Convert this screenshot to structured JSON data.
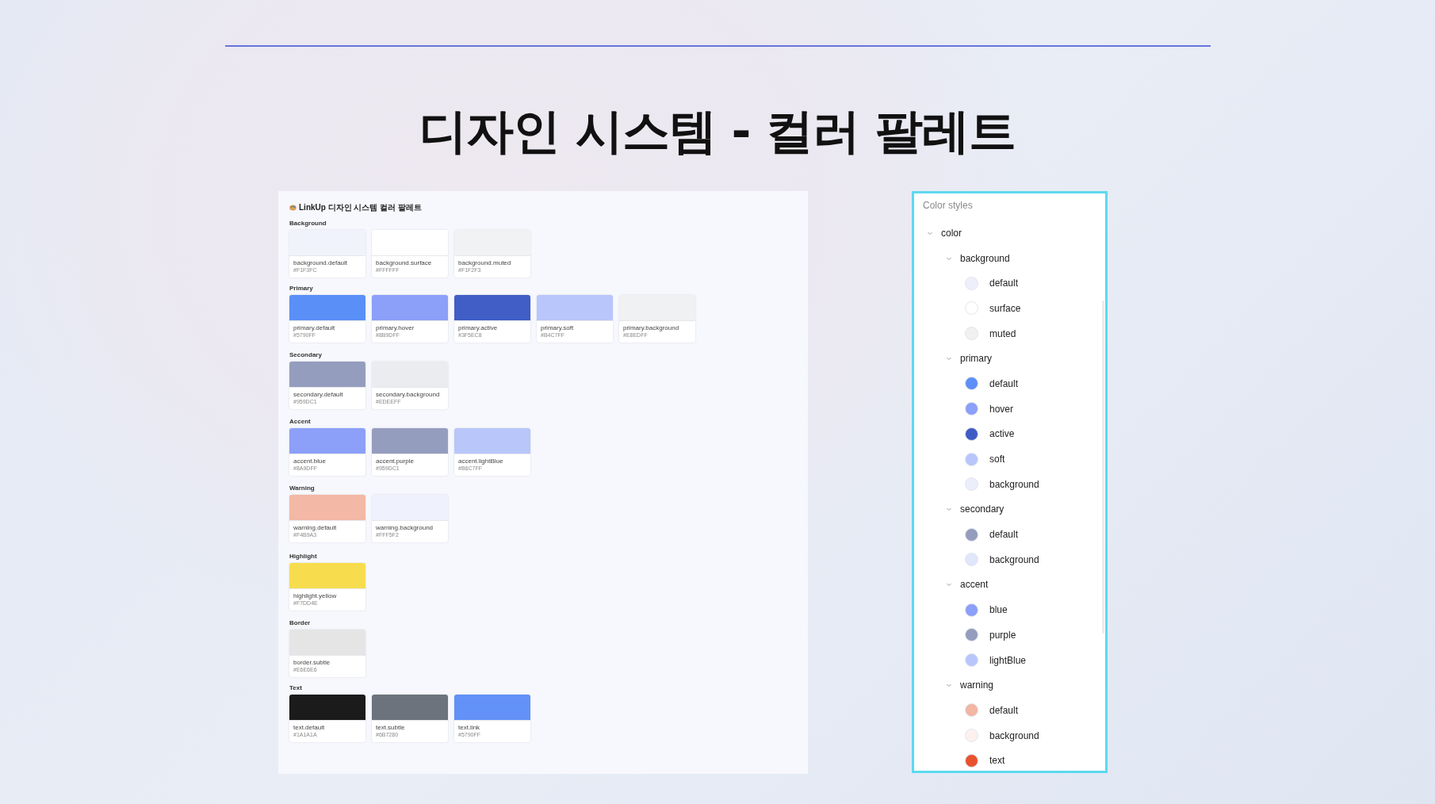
{
  "title": "디자인 시스템 - 컬러 팔레트",
  "palette": {
    "title": "LinkUp 디자인 시스템 컬러 팔레트",
    "sections": [
      {
        "heading": "Background",
        "swatches": [
          {
            "name": "background.default",
            "hex": "#F1F3FC",
            "color": "#f1f3fc"
          },
          {
            "name": "background.surface",
            "hex": "#FFFFFF",
            "color": "#ffffff"
          },
          {
            "name": "background.muted",
            "hex": "#F1F2F3",
            "color": "#f1f2f3"
          }
        ]
      },
      {
        "heading": "Primary",
        "swatches": [
          {
            "name": "primary.default",
            "hex": "#5790FF",
            "color": "#5b8ff8"
          },
          {
            "name": "primary.hover",
            "hex": "#8B9DFF",
            "color": "#8c9ff9"
          },
          {
            "name": "primary.active",
            "hex": "#3F5EC8",
            "color": "#405ec5"
          },
          {
            "name": "primary.soft",
            "hex": "#B4C7FF",
            "color": "#b8c6fb"
          },
          {
            "name": "primary.background",
            "hex": "#E8EDFF",
            "color": "#f0f1f3"
          }
        ]
      },
      {
        "heading": "Secondary",
        "swatches": [
          {
            "name": "secondary.default",
            "hex": "#959DC1",
            "color": "#959dbf"
          },
          {
            "name": "secondary.background",
            "hex": "#EDEEFF",
            "color": "#ebecef"
          }
        ]
      },
      {
        "heading": "Accent",
        "swatches": [
          {
            "name": "accent.blue",
            "hex": "#8A9DFF",
            "color": "#8c9ff9"
          },
          {
            "name": "accent.purple",
            "hex": "#959DC1",
            "color": "#959dbf"
          },
          {
            "name": "accent.lightBlue",
            "hex": "#B6C7FF",
            "color": "#b9c6fa"
          }
        ]
      },
      {
        "heading": "Warning",
        "swatches": [
          {
            "name": "warning.default",
            "hex": "#F4B9A3",
            "color": "#f3b8a6"
          },
          {
            "name": "warning.background",
            "hex": "#FFF5F2",
            "color": "#eff1fc"
          }
        ]
      },
      {
        "heading": "Highlight",
        "swatches": [
          {
            "name": "highlight.yellow",
            "hex": "#F7DD4E",
            "color": "#f7dd4e"
          }
        ]
      },
      {
        "heading": "Border",
        "swatches": [
          {
            "name": "border.subtle",
            "hex": "#E6E6E6",
            "color": "#e5e5e5"
          }
        ]
      },
      {
        "heading": "Text",
        "swatches": [
          {
            "name": "text.default",
            "hex": "#1A1A1A",
            "color": "#1b1b1b"
          },
          {
            "name": "text.subtle",
            "hex": "#6B7280",
            "color": "#6c737c"
          },
          {
            "name": "text.link",
            "hex": "#5790FF",
            "color": "#6291f7"
          }
        ]
      }
    ]
  },
  "color_styles": {
    "header": "Color styles",
    "tree": [
      {
        "label": "color",
        "expanded": true,
        "children": [
          {
            "label": "background",
            "expanded": true,
            "children": [
              {
                "label": "default",
                "color": "#edf0fa"
              },
              {
                "label": "surface",
                "color": "#ffffff"
              },
              {
                "label": "muted",
                "color": "#f1f1f1"
              }
            ]
          },
          {
            "label": "primary",
            "expanded": true,
            "children": [
              {
                "label": "default",
                "color": "#5e8ff8"
              },
              {
                "label": "hover",
                "color": "#8c9ff9"
              },
              {
                "label": "active",
                "color": "#3e5cc4"
              },
              {
                "label": "soft",
                "color": "#b8c6fb"
              },
              {
                "label": "background",
                "color": "#ebeefb"
              }
            ]
          },
          {
            "label": "secondary",
            "expanded": true,
            "children": [
              {
                "label": "default",
                "color": "#959dbf"
              },
              {
                "label": "background",
                "color": "#e0e7fb"
              }
            ]
          },
          {
            "label": "accent",
            "expanded": true,
            "children": [
              {
                "label": "blue",
                "color": "#8c9ff9"
              },
              {
                "label": "purple",
                "color": "#959dbf"
              },
              {
                "label": "lightBlue",
                "color": "#b8c6fb"
              }
            ]
          },
          {
            "label": "warning",
            "expanded": true,
            "children": [
              {
                "label": "default",
                "color": "#f2b6a3"
              },
              {
                "label": "background",
                "color": "#fcf1ee"
              },
              {
                "label": "text",
                "color": "#e9522e"
              }
            ]
          }
        ]
      }
    ]
  }
}
